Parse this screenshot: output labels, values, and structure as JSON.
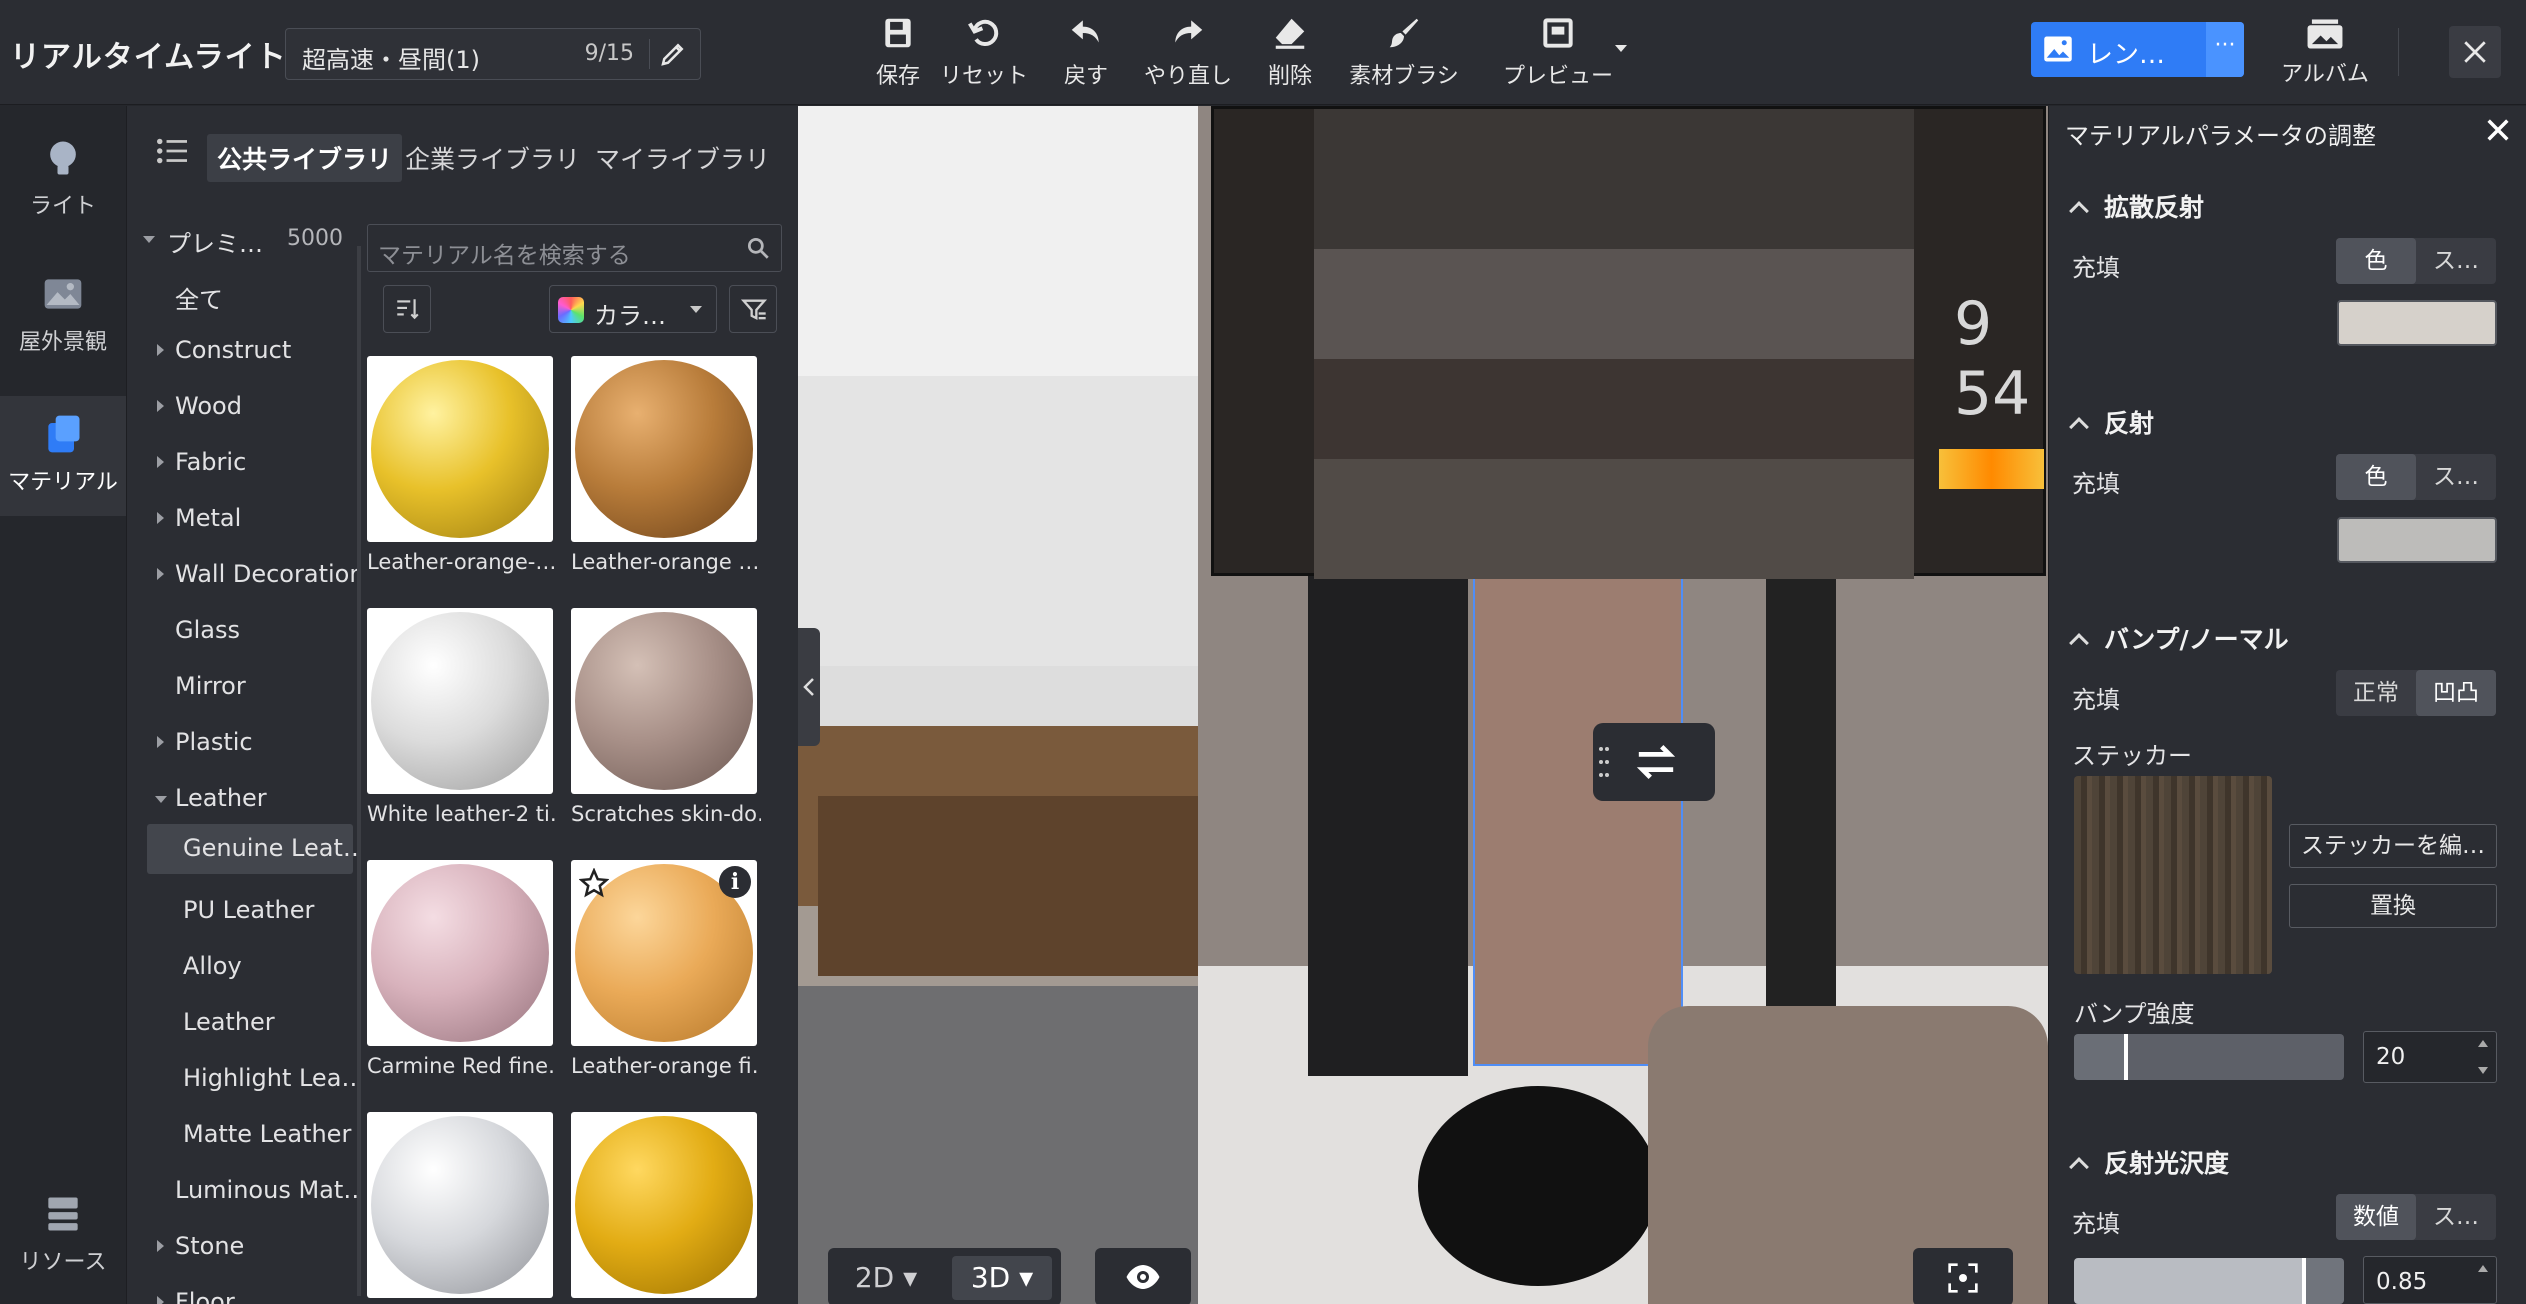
{
  "app": {
    "title": "リアルタイムライト"
  },
  "scene": {
    "name": "超高速・昼間(1)",
    "count": "9/15"
  },
  "toolbar": {
    "save": "保存",
    "reset": "リセット",
    "undo": "戻す",
    "redo": "やり直し",
    "delete": "削除",
    "brush": "素材ブラシ",
    "preview": "プレビュー",
    "render": "レン…",
    "render_more": "···",
    "album": "アルバム"
  },
  "rail": {
    "light": "ライト",
    "outdoor": "屋外景観",
    "material": "マテリアル",
    "resource": "リソース"
  },
  "library": {
    "tabs": [
      "公共ライブラリ",
      "企業ライブラリ",
      "マイライブラリ"
    ],
    "search_placeholder": "マテリアル名を検索する",
    "color_filter": "カラ…",
    "tree": [
      {
        "label": "プレミ…",
        "count": "5000"
      },
      {
        "label": "全て"
      },
      {
        "label": "Construct"
      },
      {
        "label": "Wood"
      },
      {
        "label": "Fabric"
      },
      {
        "label": "Metal"
      },
      {
        "label": "Wall Decoration"
      },
      {
        "label": "Glass"
      },
      {
        "label": "Mirror"
      },
      {
        "label": "Plastic"
      },
      {
        "label": "Leather"
      },
      {
        "label": "Genuine Leat…"
      },
      {
        "label": "PU Leather"
      },
      {
        "label": "Alloy"
      },
      {
        "label": "Leather"
      },
      {
        "label": "Highlight Lea…"
      },
      {
        "label": "Matte Leather"
      },
      {
        "label": "Luminous Mat…"
      },
      {
        "label": "Stone"
      },
      {
        "label": "Floor"
      }
    ],
    "materials": [
      {
        "name": "Leather-orange-…",
        "color": "#e8c12a"
      },
      {
        "name": "Leather-orange …",
        "color": "#b87c3a"
      },
      {
        "name": "White leather-2 ti…",
        "color": "#dcdcdc"
      },
      {
        "name": "Scratches skin-do…",
        "color": "#a89088"
      },
      {
        "name": "Carmine Red fine…",
        "color": "#d8b2bc"
      },
      {
        "name": "Leather-orange fi…",
        "color": "#eaaa58"
      },
      {
        "name": "",
        "color": "#d6d8dc"
      },
      {
        "name": "",
        "color": "#e2ac14"
      }
    ]
  },
  "viewport": {
    "inset_number": "9 54",
    "view_2d": "2D",
    "view_3d": "3D"
  },
  "panel": {
    "title": "マテリアルパラメータの調整",
    "diffuse": {
      "title": "拡散反射",
      "fill_label": "充填",
      "opt_color": "色",
      "opt_other": "ス…",
      "swatch": "#d6d1cb"
    },
    "reflection": {
      "title": "反射",
      "fill_label": "充填",
      "opt_color": "色",
      "opt_other": "ス…",
      "swatch": "#bdbcba"
    },
    "bump": {
      "title": "バンプ/ノーマル",
      "fill_label": "充填",
      "opt_normal": "正常",
      "opt_bump": "凹凸",
      "sticker_label": "ステッカー",
      "edit_btn": "ステッカーを編…",
      "replace_btn": "置換",
      "strength_label": "バンプ強度",
      "strength_value": "20"
    },
    "gloss": {
      "title": "反射光沢度",
      "fill_label": "充填",
      "opt_value": "数値",
      "opt_other": "ス…",
      "value": "0.85"
    }
  }
}
